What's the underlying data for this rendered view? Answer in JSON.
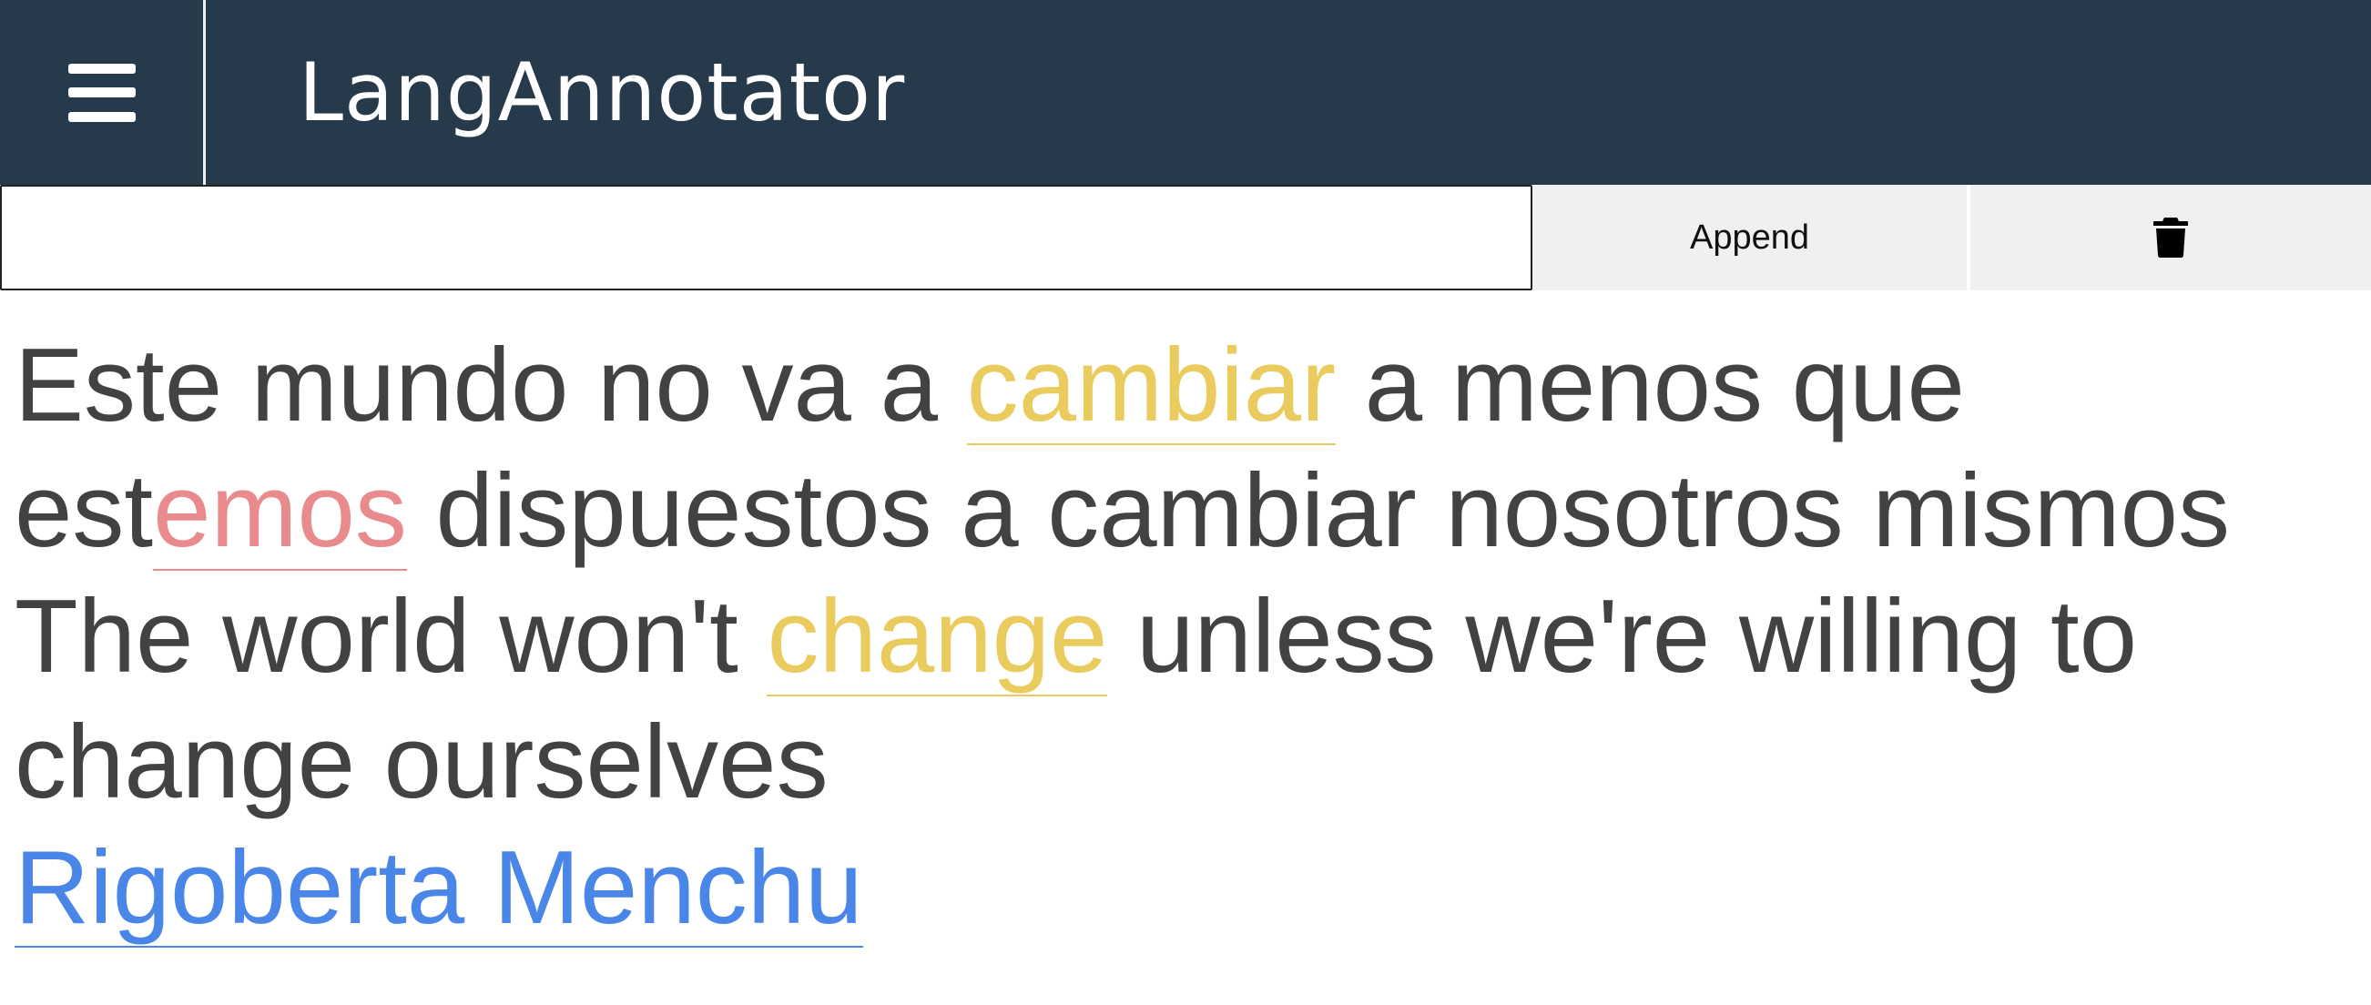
{
  "app": {
    "title": "LangAnnotator",
    "menu_icon": "hamburger-menu-icon"
  },
  "toolbar": {
    "input_value": "",
    "input_placeholder": "",
    "append_label": "Append",
    "delete_icon": "trash-icon"
  },
  "colors": {
    "header_bg": "#263a4c",
    "toolbar_bg": "#eef1ee",
    "text": "#424242",
    "highlight_yellow": "#e9cb5e",
    "highlight_red": "#e98a8c",
    "link_blue": "#4a86e8"
  },
  "quote": {
    "spanish": {
      "l1_a": "Este mundo no va a ",
      "l1_word": "cambiar",
      "l1_b": " a menos que",
      "l2_prefix": "est",
      "l2_suffix": "emos",
      "l2_rest": " dispuestos a cambiar nosotros mismos"
    },
    "english": {
      "l3_a": "The world won't ",
      "l3_word": "change",
      "l3_b": " unless we're willing to",
      "l4": "change ourselves"
    },
    "author": "Rigoberta Menchu"
  }
}
